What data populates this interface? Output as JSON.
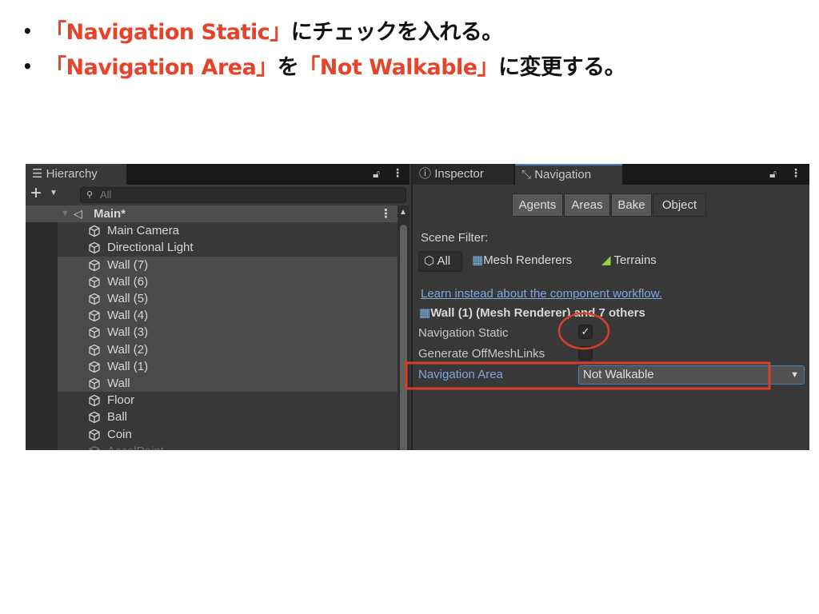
{
  "slide": {
    "bullets": [
      {
        "parts": [
          {
            "text": "「Navigation Static」",
            "red": true
          },
          {
            "text": "にチェックを入れる。",
            "red": false
          }
        ]
      },
      {
        "parts": [
          {
            "text": "「Navigation Area」",
            "red": true
          },
          {
            "text": "を",
            "red": false
          },
          {
            "text": "「Not Walkable」",
            "red": true
          },
          {
            "text": "に変更する。",
            "red": false
          }
        ]
      }
    ],
    "accent_color": "#e6432b"
  },
  "hierarchy": {
    "tab_label": "Hierarchy",
    "add_label": "+",
    "search_placeholder": "All",
    "scene": "Main*",
    "items": [
      {
        "label": "Main Camera",
        "selected": false
      },
      {
        "label": "Directional Light",
        "selected": false
      },
      {
        "label": "Wall (7)",
        "selected": true
      },
      {
        "label": "Wall (6)",
        "selected": true
      },
      {
        "label": "Wall (5)",
        "selected": true
      },
      {
        "label": "Wall (4)",
        "selected": true
      },
      {
        "label": "Wall (3)",
        "selected": true
      },
      {
        "label": "Wall (2)",
        "selected": true
      },
      {
        "label": "Wall (1)",
        "selected": true
      },
      {
        "label": "Wall",
        "selected": true
      },
      {
        "label": "Floor",
        "selected": false
      },
      {
        "label": "Ball",
        "selected": false
      },
      {
        "label": "Coin",
        "selected": false
      },
      {
        "label": "AccelPoint",
        "selected": false
      }
    ]
  },
  "inspector": {
    "tabs": [
      {
        "label": "Inspector",
        "icon": "info-icon"
      },
      {
        "label": "Navigation",
        "icon": "navigation-icon",
        "active": true
      }
    ],
    "segments": [
      "Agents",
      "Areas",
      "Bake",
      "Object"
    ],
    "active_segment": "Object",
    "scene_filter_label": "Scene Filter:",
    "filters": [
      "All",
      "Mesh Renderers",
      "Terrains"
    ],
    "link": "Learn instead about the component workflow.",
    "object_header": "Wall (1) (Mesh Renderer) and 7 others",
    "navigation_static_label": "Navigation Static",
    "navigation_static": true,
    "offmesh_label": "Generate OffMeshLinks",
    "offmesh": false,
    "area_label": "Navigation Area",
    "area_value": "Not Walkable"
  }
}
